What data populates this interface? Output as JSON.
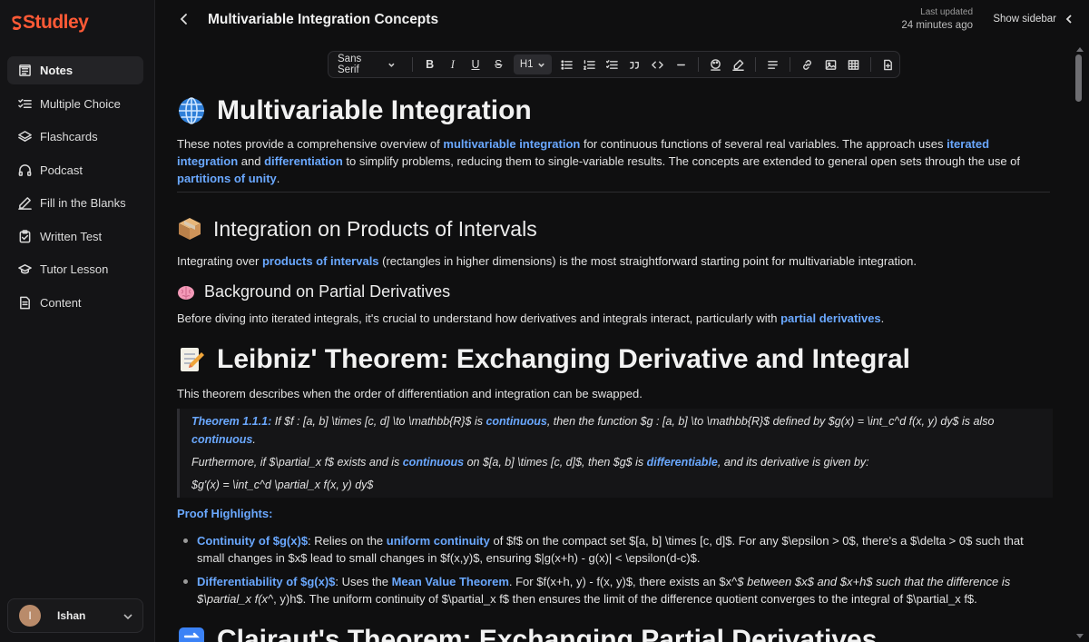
{
  "brand": {
    "name": "Studley",
    "color": "#ff5a36"
  },
  "sidebar": {
    "items": [
      {
        "label": "Notes",
        "icon": "notes-icon",
        "active": true
      },
      {
        "label": "Multiple Choice",
        "icon": "checklist-icon"
      },
      {
        "label": "Flashcards",
        "icon": "layers-icon"
      },
      {
        "label": "Podcast",
        "icon": "headphones-icon"
      },
      {
        "label": "Fill in the Blanks",
        "icon": "pencil-icon"
      },
      {
        "label": "Written Test",
        "icon": "clipboard-icon"
      },
      {
        "label": "Tutor Lesson",
        "icon": "graduation-cap-icon"
      },
      {
        "label": "Content",
        "icon": "document-icon"
      }
    ],
    "user": {
      "initial": "I",
      "name": "Ishan"
    }
  },
  "header": {
    "title": "Multivariable Integration Concepts",
    "updated_label": "Last updated",
    "updated_value": "24 minutes ago",
    "show_sidebar": "Show sidebar"
  },
  "toolbar": {
    "font": "Sans Serif",
    "heading": "H1",
    "buttons": [
      "B",
      "I",
      "U",
      "S"
    ]
  },
  "doc": {
    "h1_main": "Multivariable Integration",
    "intro": {
      "t1": "These notes provide a comprehensive overview of ",
      "l1": "multivariable integration",
      "t2": " for continuous functions of several real variables. The approach uses ",
      "l2": "iterated integration",
      "t3": " and ",
      "l3": "differentiation",
      "t4": " to simplify problems, reducing them to single-variable results. The concepts are extended to general open sets through the use of ",
      "l4": "partitions of unity",
      "t5": "."
    },
    "h2_products": "Integration on Products of Intervals",
    "products": {
      "t1": "Integrating over ",
      "l1": "products of intervals",
      "t2": " (rectangles in higher dimensions) is the most straightforward starting point for multivariable integration."
    },
    "h3_partials": "Background on Partial Derivatives",
    "partials": {
      "t1": "Before diving into iterated integrals, it's crucial to understand how derivatives and integrals interact, particularly with ",
      "l1": "partial derivatives",
      "t2": "."
    },
    "h1_leibniz": "Leibniz' Theorem: Exchanging Derivative and Integral",
    "leibniz_intro": "This theorem describes when the order of differentiation and integration can be swapped.",
    "theorem": {
      "head": "Theorem 1.1.1:",
      "t1": " If $f : [a, b] \\times [c, d] \\to \\mathbb{R}$ is ",
      "l1": "continuous",
      "t2": ", then the function $g : [a, b] \\to \\mathbb{R}$ defined by $g(x) = \\int_c^d f(x, y) dy$ is also ",
      "l2": "continuous",
      "t3": ".",
      "p2_t1": "Furthermore, if $\\partial_x f$ exists and is ",
      "p2_l1": "continuous",
      "p2_t2": " on $[a, b] \\times [c, d]$, then $g$ is ",
      "p2_l2": "differentiable",
      "p2_t3": ", and its derivative is given by:",
      "p3": "$g'(x) = \\int_c^d \\partial_x f(x, y) dy$"
    },
    "proof_head": "Proof Highlights:",
    "bullet1": {
      "l1": "Continuity of $g(x)$",
      "t1": ": Relies on the ",
      "l2": "uniform continuity",
      "t2": " of $f$ on the compact set $[a, b] \\times [c, d]$. For any $\\epsilon > 0$, there's a $\\delta > 0$ such that small changes in $x$ lead to small changes in $f(x,y)$, ensuring $|g(x+h) - g(x)| < \\epsilon(d-c)$."
    },
    "bullet2": {
      "l1": "Differentiability of $g(x)$",
      "t1": ": Uses the ",
      "l2": "Mean Value Theorem",
      "t2": ". For $f(x+h, y) - f(x, y)$, there exists an $x^",
      "t2i": "$ between $x$ and $x+h$ such that the difference is $\\partial_x f(x^",
      "t3": ", y)h$. The uniform continuity of $\\partial_x f$ then ensures the limit of the difference quotient converges to the integral of $\\partial_x f$."
    },
    "h1_clairaut": "Clairaut's Theorem: Exchanging Partial Derivatives"
  }
}
